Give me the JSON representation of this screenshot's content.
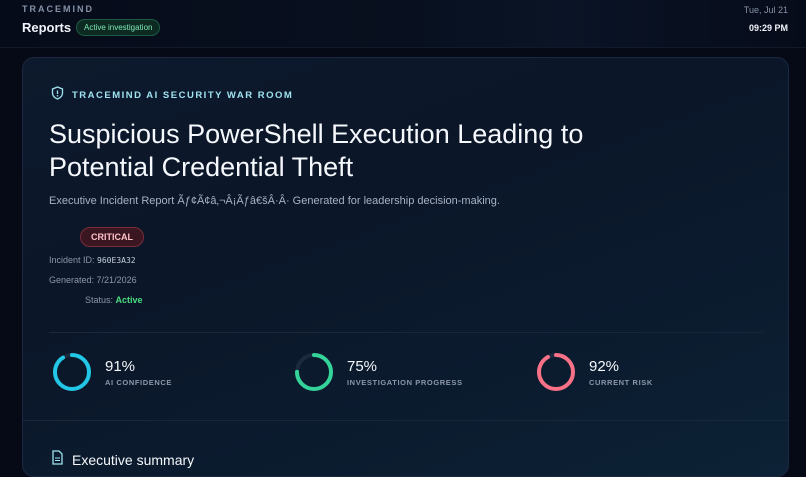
{
  "header": {
    "brand": "TRACEMIND",
    "section": "Reports",
    "badge": "Active investigation",
    "date": "Tue, Jul 21",
    "time": "09:29 PM"
  },
  "report": {
    "eyebrow": "TRACEMIND AI SECURITY WAR ROOM",
    "title": "Suspicious PowerShell Execution Leading to Potential Credential Theft",
    "subtitle": "Executive Incident Report Ãƒ¢Ã¢â‚¬Â¡Ãƒâ€šÂ·Â· Generated for leadership decision-making.",
    "severity": "CRITICAL",
    "incident_id_label": "Incident ID:",
    "incident_id": "960E3A32",
    "generated_label": "Generated:",
    "generated": "7/21/2026",
    "status_label": "Status:",
    "status": "Active"
  },
  "metrics": [
    {
      "value": "91%",
      "label": "AI CONFIDENCE",
      "fraction": 0.91,
      "color": "#22c7e6"
    },
    {
      "value": "75%",
      "label": "INVESTIGATION PROGRESS",
      "fraction": 0.75,
      "color": "#34d399"
    },
    {
      "value": "92%",
      "label": "CURRENT RISK",
      "fraction": 0.92,
      "color": "#f87186"
    }
  ],
  "summary": {
    "title": "Executive summary"
  },
  "icons": {
    "eyebrow": "shield-icon",
    "summary": "document-icon"
  }
}
